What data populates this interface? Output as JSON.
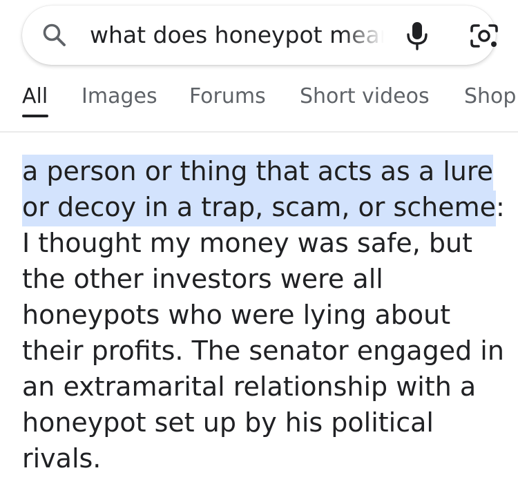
{
  "search": {
    "query": "what does honeypot mean",
    "icons": {
      "search": "search-icon",
      "voice": "mic-icon",
      "lens": "camera-lens-icon"
    }
  },
  "tabs": [
    {
      "label": "All",
      "active": true
    },
    {
      "label": "Images",
      "active": false
    },
    {
      "label": "Forums",
      "active": false
    },
    {
      "label": "Short videos",
      "active": false
    },
    {
      "label": "Shop",
      "active": false
    }
  ],
  "definition": {
    "highlighted": "a person or thing that acts as a lure or decoy in a trap, scam, or scheme",
    "rest": ": I thought my money was safe, but the other investors were all honeypots who were lying about their profits. The senator engaged in an extramarital relationship with a honeypot set up by his political rivals."
  },
  "colors": {
    "highlight": "#d3e3fd",
    "text": "#202124",
    "muted": "#5f6368"
  }
}
